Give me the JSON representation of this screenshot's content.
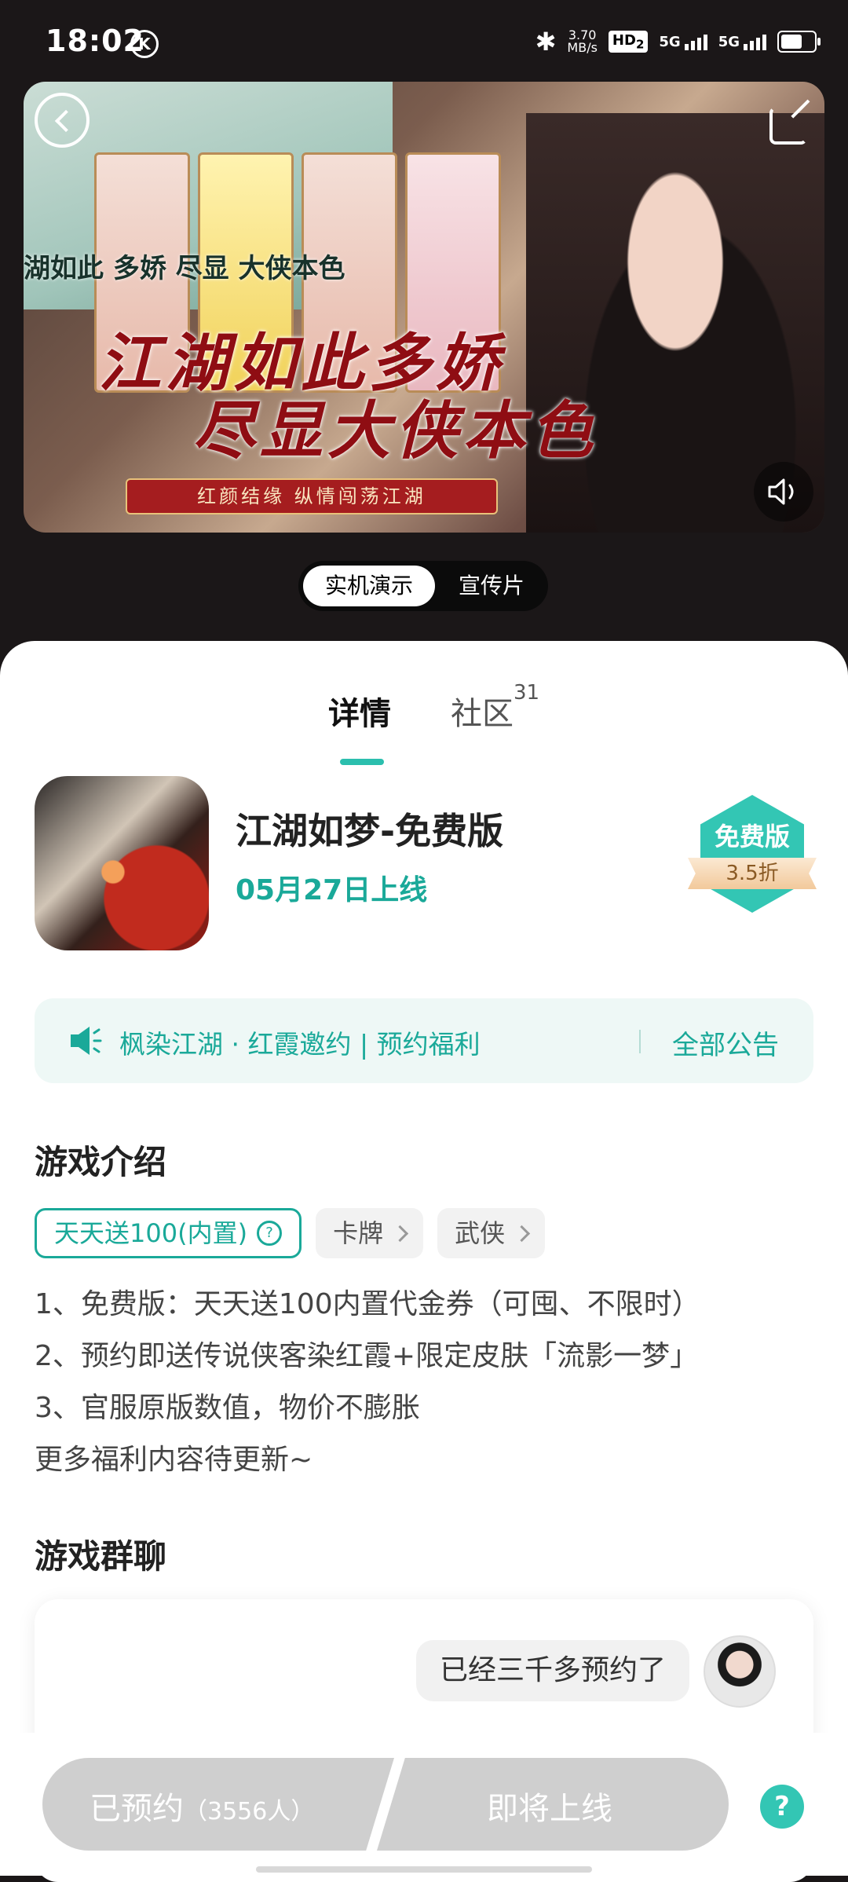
{
  "status_bar": {
    "time": "18:02",
    "k_badge": "K",
    "net_speed_value": "3.70",
    "net_speed_unit": "MB/s",
    "hd_label": "HD",
    "hd_sub": "2",
    "sim1": "5G",
    "sim2": "5G"
  },
  "banner": {
    "top_text": "湖如此 多娇 尽显 大侠本色",
    "calligraphy_line1": "江湖如此多娇",
    "calligraphy_line2": "尽显大侠本色",
    "tagline": "红颜结缘  纵情闯荡江湖"
  },
  "media_toggle": {
    "option_1": "实机演示",
    "option_2": "宣传片"
  },
  "tabs": {
    "details": "详情",
    "community": "社区",
    "community_count": "31"
  },
  "app": {
    "name": "江湖如梦-免费版",
    "release": "05月27日上线",
    "badge_top": "免费版",
    "badge_discount": "3.5折"
  },
  "notice": {
    "text": "枫染江湖 · 红霞邀约 | 预约福利",
    "all_link": "全部公告"
  },
  "intro": {
    "title": "游戏介绍",
    "tag_primary": "天天送100(内置)",
    "tag_help": "?",
    "tag_2": "卡牌",
    "tag_3": "武侠",
    "line_1": "1、免费版：天天送100内置代金券（可囤、不限时）",
    "line_2": "2、预约即送传说侠客染红霞+限定皮肤「流影一梦」",
    "line_3": "3、官服原版数值，物价不膨胀",
    "line_4": "更多福利内容待更新~"
  },
  "group_chat": {
    "title": "游戏群聊",
    "message": "已经三千多预约了"
  },
  "bottom_bar": {
    "reserved_label": "已预约",
    "reserved_count": "（3556人）",
    "coming_soon": "即将上线",
    "help": "?"
  },
  "colors": {
    "accent": "#1aa999",
    "badge": "#33c6b4",
    "button_disabled": "#cfcfcf"
  }
}
